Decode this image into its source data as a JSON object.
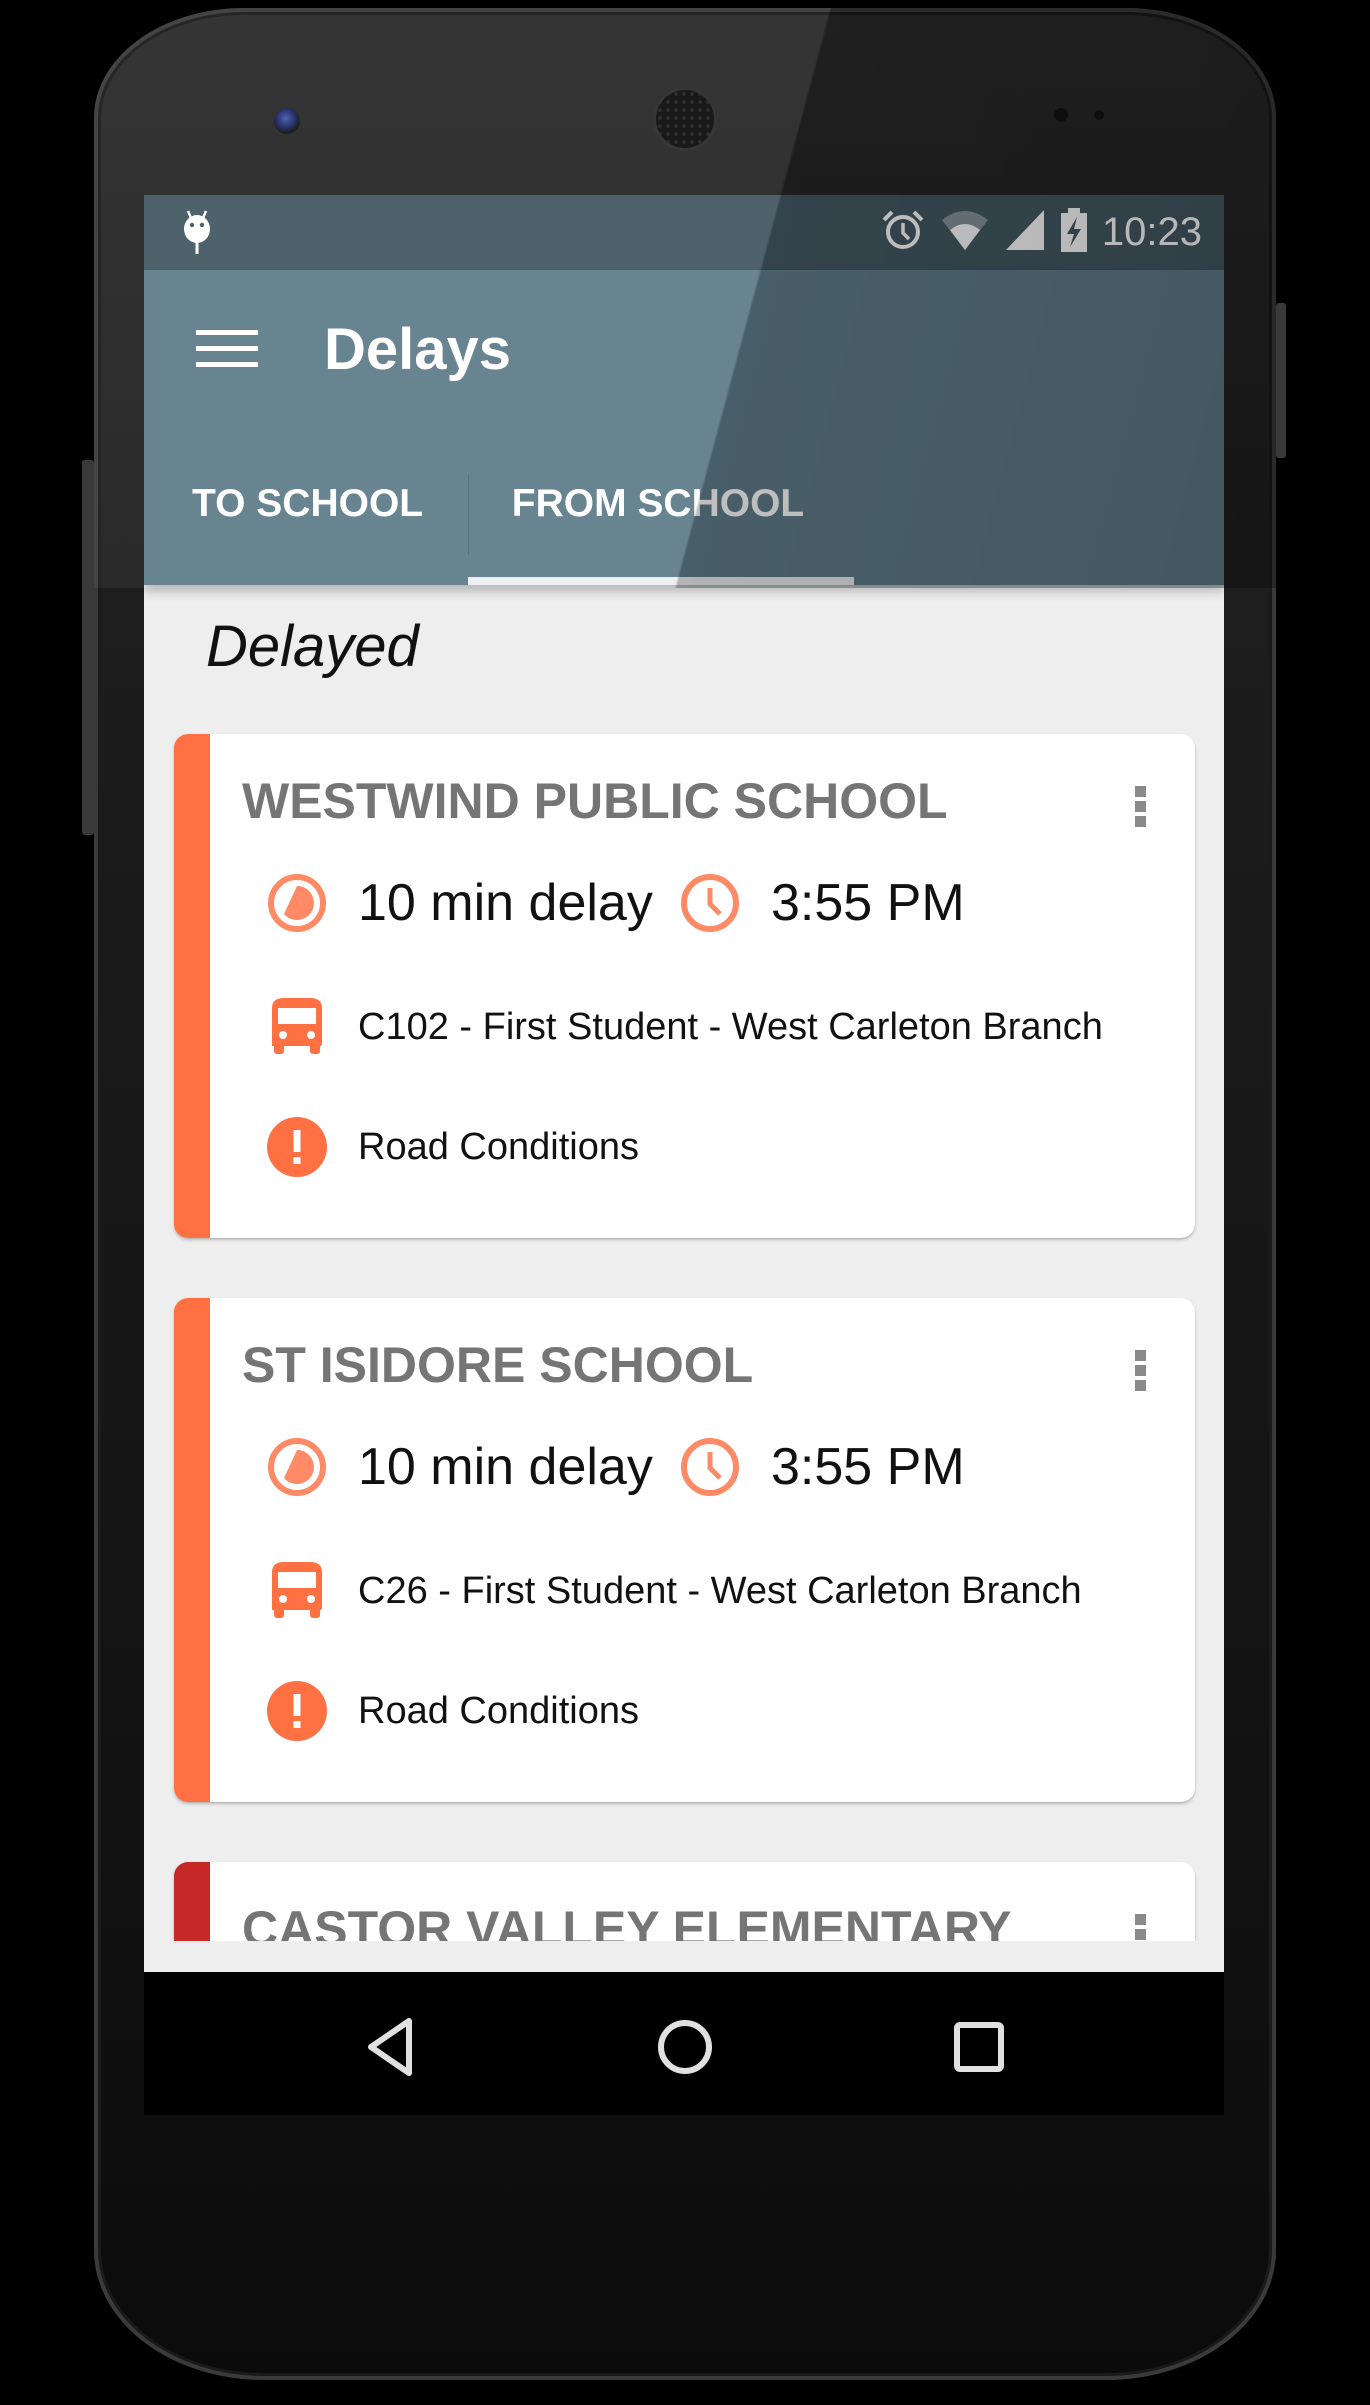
{
  "status_bar": {
    "time": "10:23",
    "left_icons": [
      "android-debug-icon"
    ],
    "right_icons": [
      "alarm-icon",
      "wifi-icon",
      "signal-icon",
      "battery-charging-icon"
    ]
  },
  "app_bar": {
    "title": "Delays",
    "menu_icon": "hamburger-menu-icon"
  },
  "tabs": [
    {
      "label": "TO SCHOOL",
      "selected": false
    },
    {
      "label": "FROM SCHOOL",
      "selected": true
    }
  ],
  "section": {
    "title": "Delayed"
  },
  "colors": {
    "status_bar": "#455a64",
    "app_bar": "#607d8b",
    "accent_orange": "#ff7043",
    "accent_red": "#c62828",
    "icon_orange": "#ff8a65",
    "title_gray": "#757575",
    "background": "#eeeeee"
  },
  "cards": [
    {
      "school": "WESTWIND PUBLIC SCHOOL",
      "status_color": "#ff7043",
      "delay": "10 min delay",
      "time": "3:55 PM",
      "route": "C102 - First Student - West Carleton Branch",
      "reason": "Road Conditions"
    },
    {
      "school": "ST ISIDORE SCHOOL",
      "status_color": "#ff7043",
      "delay": "10 min delay",
      "time": "3:55 PM",
      "route": "C26 - First Student - West Carleton Branch",
      "reason": "Road Conditions"
    },
    {
      "school": "CASTOR VALLEY ELEMENTARY",
      "status_color": "#c62828"
    }
  ],
  "nav_bar": {
    "buttons": [
      "back",
      "home",
      "recents"
    ]
  }
}
